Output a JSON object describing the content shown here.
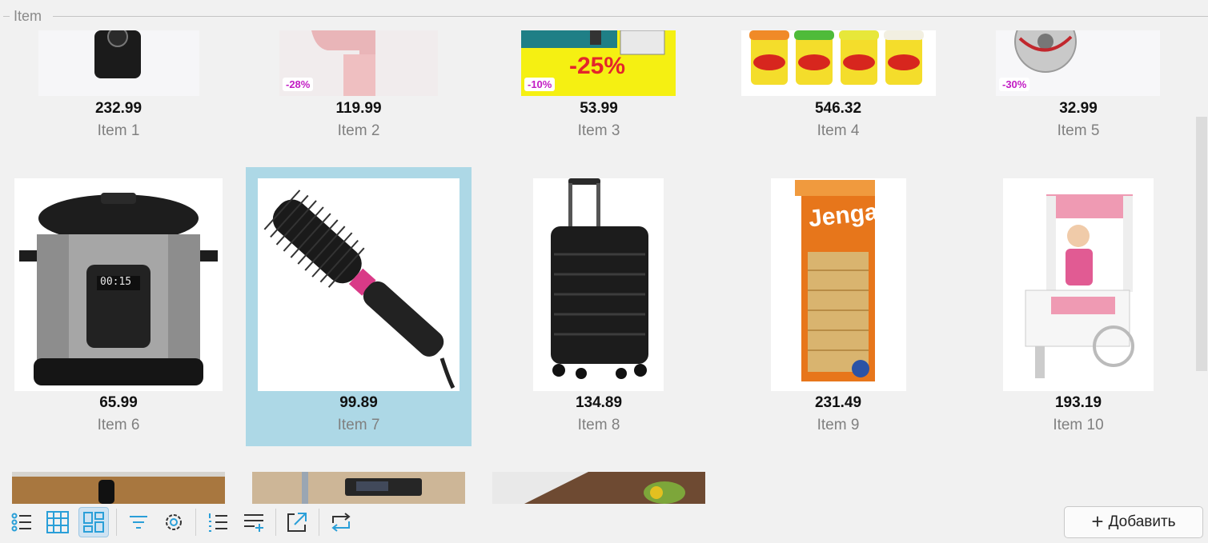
{
  "group": {
    "title": "Item"
  },
  "items": [
    {
      "price": "232.99",
      "name": "Item 1",
      "discount": ""
    },
    {
      "price": "119.99",
      "name": "Item 2",
      "discount": "-28%"
    },
    {
      "price": "53.99",
      "name": "Item 3",
      "discount": "-10%",
      "banner": "-25%"
    },
    {
      "price": "546.32",
      "name": "Item 4",
      "discount": ""
    },
    {
      "price": "32.99",
      "name": "Item 5",
      "discount": "-30%"
    },
    {
      "price": "65.99",
      "name": "Item 6",
      "discount": "",
      "label": "00:15"
    },
    {
      "price": "99.89",
      "name": "Item 7",
      "discount": ""
    },
    {
      "price": "134.89",
      "name": "Item 8",
      "discount": ""
    },
    {
      "price": "231.49",
      "name": "Item 9",
      "discount": "",
      "label": "Jenga"
    },
    {
      "price": "193.19",
      "name": "Item 10",
      "discount": ""
    }
  ],
  "selected_item": "Item 7",
  "toolbar": {
    "buttons": [
      "list-view-icon",
      "table-view-icon",
      "tile-view-icon",
      "filter-icon",
      "settings-icon",
      "numbered-list-icon",
      "add-row-icon",
      "open-external-icon",
      "refresh-icon"
    ],
    "active": "tile-view-icon",
    "add_label": "Добавить"
  },
  "colors": {
    "selection": "#add8e6",
    "accent": "#2a9fd8",
    "discount": "#c21cc4"
  }
}
